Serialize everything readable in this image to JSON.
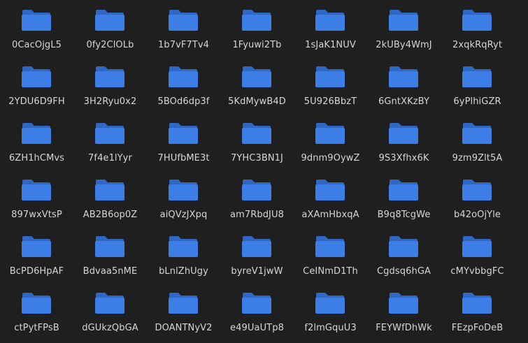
{
  "icon": "folder-icon",
  "colors": {
    "background": "#1f1f1f",
    "folder_front": "#3c7ee6",
    "folder_back": "#2f67c4",
    "label_text": "#d6d6d6"
  },
  "rows": [
    [
      "0CacOjgL5",
      "0fy2ClOLb",
      "1b7vF7Tv4",
      "1Fyuwi2Tb",
      "1sJaK1NUV",
      "2kUBy4WmJ",
      "2xqkRqRyt"
    ],
    [
      "2YDU6D9FH",
      "3H2Ryu0x2",
      "5BOd6dp3f",
      "5KdMywB4D",
      "5U926BbzT",
      "6GntXKzBY",
      "6yPlhiGZR"
    ],
    [
      "6ZH1hCMvs",
      "7f4e1lYyr",
      "7HUfbME3t",
      "7YHC3BN1J",
      "9dnm9OywZ",
      "9S3Xfhx6K",
      "9zm9Zlt5A"
    ],
    [
      "897wxVtsP",
      "AB2B6op0Z",
      "aiQVzJXpq",
      "am7RbdJU8",
      "aXAmHbxqA",
      "B9q8TcgWe",
      "b42oOjYle"
    ],
    [
      "BcPD6HpAF",
      "Bdvaa5nME",
      "bLnlZhUgy",
      "byreV1jwW",
      "CeINmD1Th",
      "Cgdsq6hGA",
      "cMYvbbgFC"
    ],
    [
      "ctPytFPsB",
      "dGUkzQbGA",
      "DOANTNyV2",
      "e49UaUTp8",
      "f2lmGquU3",
      "FEYWfDhWk",
      "FEzpFoDeB"
    ]
  ]
}
